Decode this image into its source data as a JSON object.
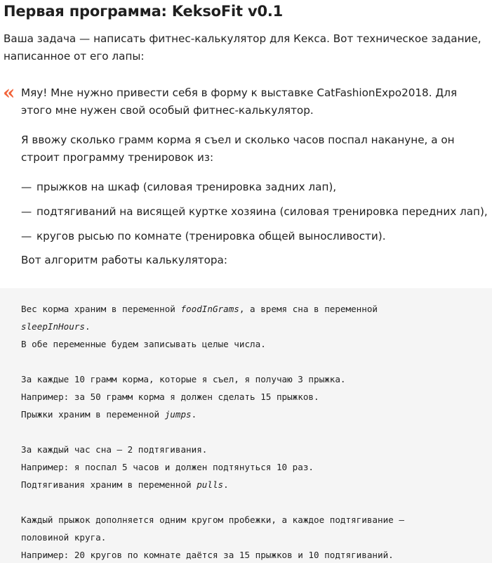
{
  "title": "Первая программа: KeksoFit v0.1",
  "intro": "Ваша задача — написать фитнес-калькулятор для Кекса. Вот техническое задание, написанное от его лапы:",
  "quote": {
    "mark": "«",
    "p1": "Мяу! Мне нужно привести себя в форму к выставке CatFashionExpo2018. Для этого мне нужен свой особый фитнес-калькулятор.",
    "p2": "Я ввожу сколько грамм корма я съел и сколько часов поспал накануне, а он строит программу тренировок из:",
    "list_marker": "—",
    "list": [
      "прыжков на шкаф (силовая тренировка задних лап),",
      "подтягиваний на висящей куртке хозяина (силовая тренировка передних лап),",
      "кругов рысью по комнате (тренировка общей выносливости)."
    ],
    "p3": "Вот алгоритм работы калькулятора:"
  },
  "code": {
    "l1_a": "Вес корма храним в переменной ",
    "l1_var": "foodInGrams",
    "l1_b": ", а время сна в переменной",
    "l2_var": "sleepInHours",
    "l2_b": ".",
    "l3": "В обе переменные будем записывать целые числа.",
    "l5": "За каждые 10 грамм корма, которые я съел, я получаю 3 прыжка.",
    "l6": "Например: за 50 грамм корма я должен сделать 15 прыжков.",
    "l7_a": "Прыжки храним в переменной ",
    "l7_var": "jumps",
    "l7_b": ".",
    "l9": "За каждый час сна — 2 подтягивания.",
    "l10": "Например: я поспал 5 часов и должен подтянуться 10 раз.",
    "l11_a": "Подтягивания храним в переменной ",
    "l11_var": "pulls",
    "l11_b": ".",
    "l13": "Каждый прыжок дополняется одним кругом пробежки, а каждое подтягивание —",
    "l14": "половиной круга.",
    "l15": "Например: 20 кругов по комнате даётся за 15 прыжков и 10 подтягиваний."
  }
}
